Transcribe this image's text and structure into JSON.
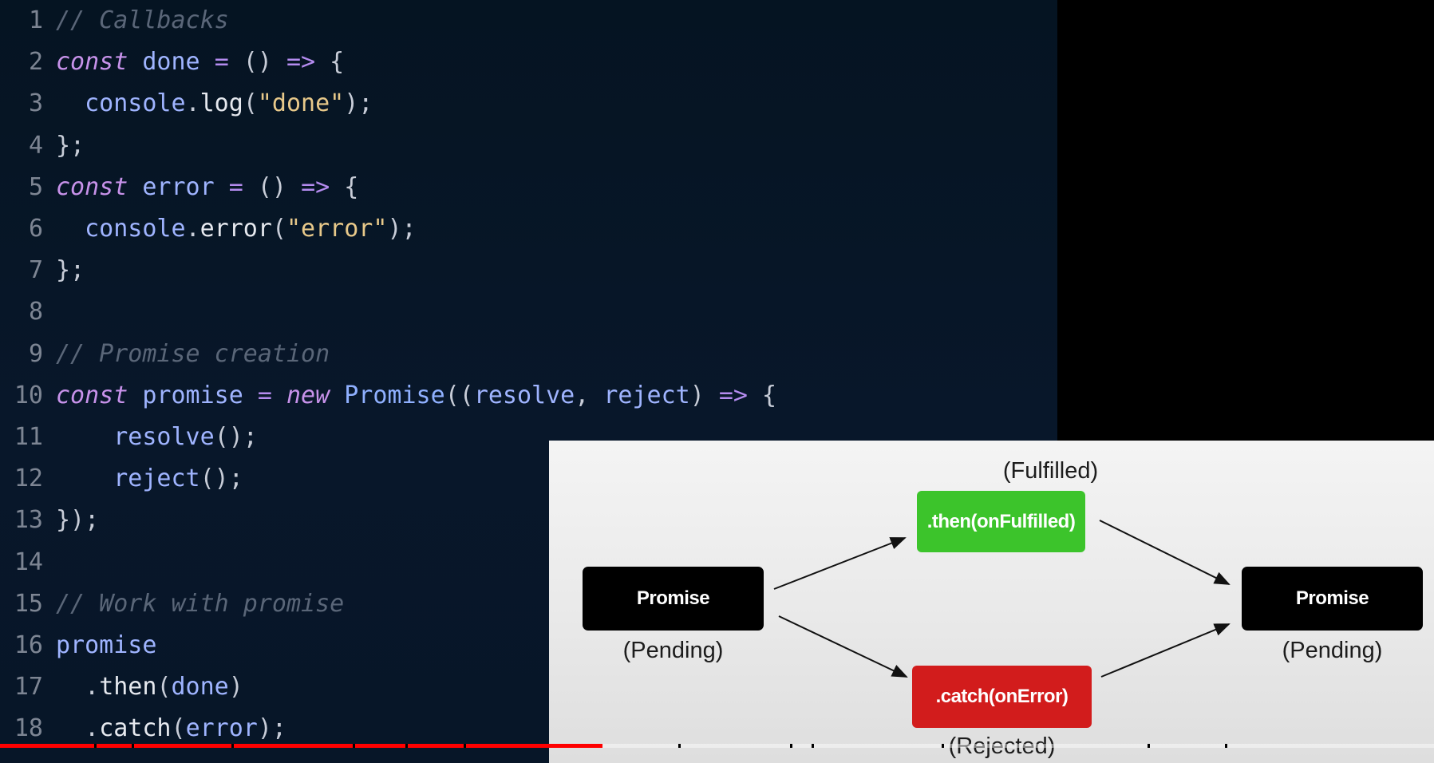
{
  "editor": {
    "lines": [
      {
        "n": "1",
        "tokens": [
          {
            "t": "// Callbacks",
            "c": "cm"
          }
        ]
      },
      {
        "n": "2",
        "tokens": [
          {
            "t": "const",
            "c": "kw"
          },
          {
            "t": " done ",
            "c": "var"
          },
          {
            "t": "=",
            "c": "op"
          },
          {
            "t": " () ",
            "c": "pn"
          },
          {
            "t": "=>",
            "c": "op"
          },
          {
            "t": " {",
            "c": "pn"
          }
        ]
      },
      {
        "n": "3",
        "tokens": [
          {
            "t": "  console",
            "c": "var"
          },
          {
            "t": ".",
            "c": "pn"
          },
          {
            "t": "log",
            "c": "fn"
          },
          {
            "t": "(",
            "c": "pn"
          },
          {
            "t": "\"done\"",
            "c": "str"
          },
          {
            "t": ");",
            "c": "pn"
          }
        ]
      },
      {
        "n": "4",
        "tokens": [
          {
            "t": "};",
            "c": "pn"
          }
        ]
      },
      {
        "n": "5",
        "tokens": [
          {
            "t": "const",
            "c": "kw"
          },
          {
            "t": " error ",
            "c": "var"
          },
          {
            "t": "=",
            "c": "op"
          },
          {
            "t": " () ",
            "c": "pn"
          },
          {
            "t": "=>",
            "c": "op"
          },
          {
            "t": " {",
            "c": "pn"
          }
        ]
      },
      {
        "n": "6",
        "tokens": [
          {
            "t": "  console",
            "c": "var"
          },
          {
            "t": ".",
            "c": "pn"
          },
          {
            "t": "error",
            "c": "fn"
          },
          {
            "t": "(",
            "c": "pn"
          },
          {
            "t": "\"error\"",
            "c": "str"
          },
          {
            "t": ");",
            "c": "pn"
          }
        ]
      },
      {
        "n": "7",
        "tokens": [
          {
            "t": "};",
            "c": "pn"
          }
        ]
      },
      {
        "n": "8",
        "tokens": []
      },
      {
        "n": "9",
        "tokens": [
          {
            "t": "// Promise creation",
            "c": "cm"
          }
        ]
      },
      {
        "n": "10",
        "tokens": [
          {
            "t": "const",
            "c": "kw"
          },
          {
            "t": " promise ",
            "c": "var"
          },
          {
            "t": "=",
            "c": "op"
          },
          {
            "t": " ",
            "c": "pn"
          },
          {
            "t": "new",
            "c": "kw"
          },
          {
            "t": " Promise",
            "c": "cls"
          },
          {
            "t": "((",
            "c": "pn"
          },
          {
            "t": "resolve",
            "c": "var"
          },
          {
            "t": ", ",
            "c": "pn"
          },
          {
            "t": "reject",
            "c": "var"
          },
          {
            "t": ") ",
            "c": "pn"
          },
          {
            "t": "=>",
            "c": "op"
          },
          {
            "t": " {",
            "c": "pn"
          }
        ]
      },
      {
        "n": "11",
        "tokens": [
          {
            "t": "    resolve",
            "c": "var"
          },
          {
            "t": "();",
            "c": "pn"
          }
        ]
      },
      {
        "n": "12",
        "tokens": [
          {
            "t": "    reject",
            "c": "var"
          },
          {
            "t": "();",
            "c": "pn"
          }
        ]
      },
      {
        "n": "13",
        "tokens": [
          {
            "t": "});",
            "c": "pn"
          }
        ]
      },
      {
        "n": "14",
        "tokens": []
      },
      {
        "n": "15",
        "tokens": [
          {
            "t": "// Work with promise",
            "c": "cm"
          }
        ]
      },
      {
        "n": "16",
        "tokens": [
          {
            "t": "promise",
            "c": "var"
          }
        ]
      },
      {
        "n": "17",
        "tokens": [
          {
            "t": "  .",
            "c": "pn"
          },
          {
            "t": "then",
            "c": "fn"
          },
          {
            "t": "(",
            "c": "pn"
          },
          {
            "t": "done",
            "c": "var"
          },
          {
            "t": ")",
            "c": "pn"
          }
        ]
      },
      {
        "n": "18",
        "tokens": [
          {
            "t": "  .",
            "c": "pn"
          },
          {
            "t": "catch",
            "c": "fn"
          },
          {
            "t": "(",
            "c": "pn"
          },
          {
            "t": "error",
            "c": "var"
          },
          {
            "t": ");",
            "c": "pn"
          }
        ]
      }
    ]
  },
  "diagram": {
    "promise_start": {
      "label": "Promise",
      "state": "(Pending)"
    },
    "then_box": {
      "label": ".then(onFulfilled)",
      "state": "(Fulfilled)"
    },
    "catch_box": {
      "label": ".catch(onError)",
      "state": "(Rejected)"
    },
    "promise_end": {
      "label": "Promise",
      "state": "(Pending)"
    }
  },
  "progress": {
    "played_fraction": 0.42
  }
}
